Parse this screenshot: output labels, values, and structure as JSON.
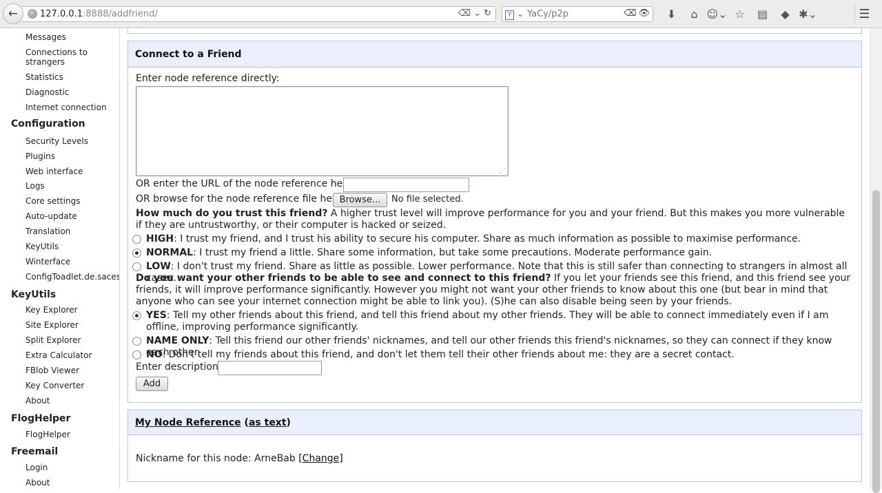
{
  "browser": {
    "url_host": "127.0.0.1",
    "url_port_path": ":8888/addfriend/",
    "search_placeholder": "YaCy/p2p"
  },
  "sidebar": {
    "items": [
      {
        "type": "item",
        "label": "Messages"
      },
      {
        "type": "item2",
        "label": "Connections to",
        "label2": "strangers"
      },
      {
        "type": "item",
        "label": "Statistics"
      },
      {
        "type": "item",
        "label": "Diagnostic"
      },
      {
        "type": "item",
        "label": "Internet connection"
      },
      {
        "type": "head",
        "label": "Configuration"
      },
      {
        "type": "item",
        "label": "Security Levels"
      },
      {
        "type": "item",
        "label": "Plugins"
      },
      {
        "type": "item",
        "label": "Web interface"
      },
      {
        "type": "item",
        "label": "Logs"
      },
      {
        "type": "item",
        "label": "Core settings"
      },
      {
        "type": "item",
        "label": "Auto-update"
      },
      {
        "type": "item",
        "label": "Translation"
      },
      {
        "type": "item",
        "label": "KeyUtils"
      },
      {
        "type": "item",
        "label": "Winterface"
      },
      {
        "type": "item",
        "label": "ConfigToadlet.de.saces.fnp"
      },
      {
        "type": "head",
        "label": "KeyUtils"
      },
      {
        "type": "item",
        "label": "Key Explorer"
      },
      {
        "type": "item",
        "label": "Site Explorer"
      },
      {
        "type": "item",
        "label": "Split Explorer"
      },
      {
        "type": "item",
        "label": "Extra Calculator"
      },
      {
        "type": "item",
        "label": "FBlob Viewer"
      },
      {
        "type": "item",
        "label": "Key Converter"
      },
      {
        "type": "item",
        "label": "About"
      },
      {
        "type": "head",
        "label": "FlogHelper"
      },
      {
        "type": "item",
        "label": "FlogHelper"
      },
      {
        "type": "head",
        "label": "Freemail"
      },
      {
        "type": "item",
        "label": "Login"
      },
      {
        "type": "item",
        "label": "About"
      }
    ]
  },
  "connect": {
    "title": "Connect to a Friend",
    "enter_ref_label": "Enter node reference directly:",
    "url_label": "OR enter the URL of the node reference here:",
    "file_label": "OR browse for the node reference file here:",
    "browse_button": "Browse...",
    "no_file": "No file selected.",
    "trust_question": "How much do you trust this friend?",
    "trust_text": " A higher trust level will improve performance for you and your friend. But this makes you more vulnerable if they are untrustworthy, or their computer is hacked or seized.",
    "trust_options": [
      {
        "label": "HIGH",
        "text": ": I trust my friend, and I trust his ability to secure his computer. Share as much information as possible to maximise performance.",
        "checked": false
      },
      {
        "label": "NORMAL",
        "text": ": I trust my friend a little. Share some information, but take some precautions. Moderate performance gain.",
        "checked": true
      },
      {
        "label": "LOW",
        "text": ": I don't trust my friend. Share as little as possible. Lower performance. Note that this is still safer than connecting to strangers in almost all cases.",
        "checked": false
      }
    ],
    "visibility_question": "Do you want your other friends to be able to see and connect to this friend?",
    "visibility_text": " If you let your friends see this friend, and this friend see your friends, it will improve performance significantly. However you might not want your other friends to know about this one (but bear in mind that anyone who can see your internet connection might be able to link you). (S)he can also disable being seen by your friends.",
    "visibility_options": [
      {
        "label": "YES",
        "text": ": Tell my other friends about this friend, and tell this friend about my other friends. They will be able to connect immediately even if I am offline, improving performance significantly.",
        "checked": true
      },
      {
        "label": "NAME ONLY",
        "text": ": Tell this friend our other friends' nicknames, and tell our other friends this friend's nicknames, so they can connect if they know each other.",
        "checked": false
      },
      {
        "label": "NO",
        "text": ": Don't tell my friends about this friend, and don't let them tell their other friends about me: they are a secret contact.",
        "checked": false
      }
    ],
    "description_label": "Enter description:",
    "add_button": "Add"
  },
  "noderef": {
    "title_link": "My Node Reference",
    "paren_open": " (",
    "as_text_link": "as text",
    "paren_close": ")",
    "nickname_label": "Nickname for this node: ArneBab ",
    "change_link": "[Change]"
  }
}
